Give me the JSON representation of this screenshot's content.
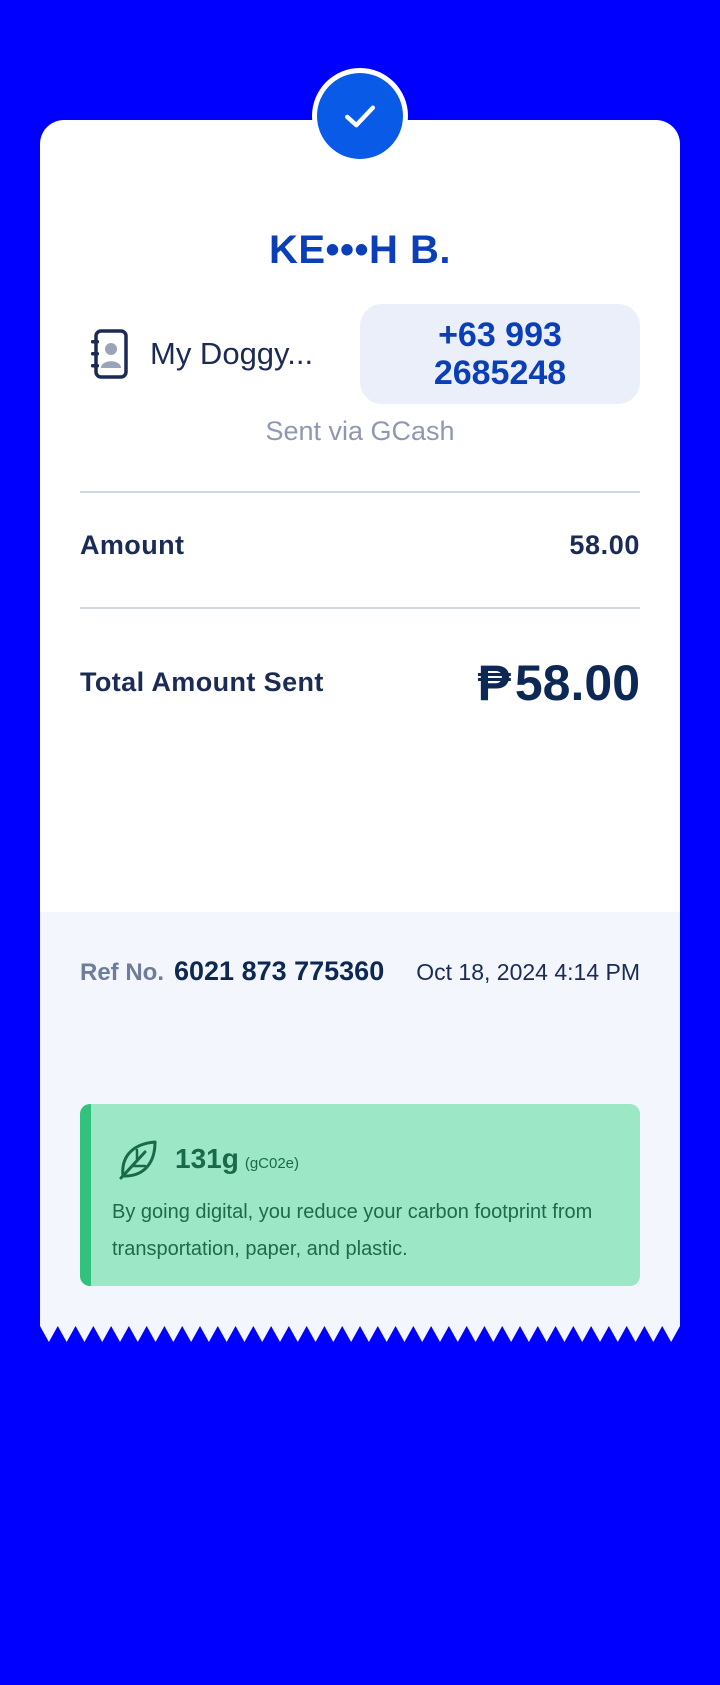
{
  "receipt": {
    "status": "success",
    "recipient_name": "KE•••H B.",
    "contact_label": "My Doggy...",
    "phone_line1": "+63 993",
    "phone_line2": "2685248",
    "sent_via": "Sent via GCash",
    "amount_label": "Amount",
    "amount_value": "58.00",
    "total_label": "Total Amount Sent",
    "total_currency": "₱",
    "total_value": "58.00",
    "ref_label": "Ref No.",
    "ref_number": "6021 873 775360",
    "datetime": "Oct 18, 2024 4:14 PM"
  },
  "eco": {
    "amount": "131g",
    "unit": "(gC02e)",
    "message": "By going digital, you reduce your carbon footprint from transportation, paper, and plastic."
  },
  "colors": {
    "background": "#0000ff",
    "brand_blue": "#0a5ae8",
    "eco_green": "#9ce8c6"
  },
  "icons": [
    "check-icon",
    "contact-book-icon",
    "leaf-icon"
  ]
}
